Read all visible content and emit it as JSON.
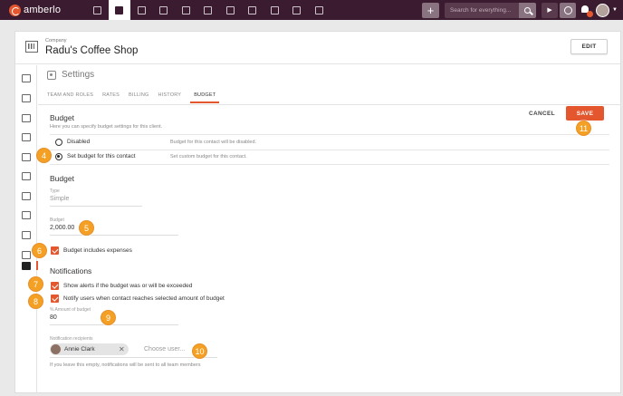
{
  "app": {
    "brand": "amberlo",
    "search_placeholder": "Search for everything...",
    "plus": "+",
    "play": "▶",
    "dropdown_caret": "▼",
    "accent_color": "#e4572e",
    "topbar_color": "#3b1b2f"
  },
  "company": {
    "label": "Company",
    "name": "Radu's Coffee Shop",
    "edit_label": "EDIT"
  },
  "settings": {
    "title": "Settings",
    "tabs": [
      "TEAM AND ROLES",
      "RATES",
      "BILLING",
      "HISTORY",
      "BUDGET"
    ],
    "active_tab": "BUDGET"
  },
  "budget": {
    "heading": "Budget",
    "hint": "Here you can specify budget settings for this client.",
    "cancel_label": "CANCEL",
    "save_label": "SAVE",
    "options": [
      {
        "label": "Disabled",
        "description": "Budget for this contact will be disabled.",
        "checked": false
      },
      {
        "label": "Set budget for this contact",
        "description": "Set custom budget for this contact.",
        "checked": true
      }
    ],
    "subheading": "Budget",
    "type_label": "Type",
    "type_value": "Simple",
    "amount_label": "Budget",
    "amount_value": "2,000.00",
    "includes_expenses_label": "Budget includes expenses",
    "includes_expenses": true
  },
  "notifications": {
    "heading": "Notifications",
    "alert_label": "Show alerts if the budget was or will be exceeded",
    "alert_checked": true,
    "notify_label": "Notify users when contact reaches selected amount of budget",
    "notify_checked": true,
    "percent_label": "% Amount of budget",
    "percent_value": "80",
    "recipients_label": "Notification recipients",
    "recipient_chip": "Annie Clark",
    "remove_symbol": "✕",
    "choose_placeholder": "Choose user...",
    "empty_hint": "If you leave this empty, notifications will be sent to all team members"
  },
  "callouts": [
    "4",
    "5",
    "6",
    "7",
    "8",
    "9",
    "10",
    "11"
  ],
  "callout_color": "#f4a024"
}
